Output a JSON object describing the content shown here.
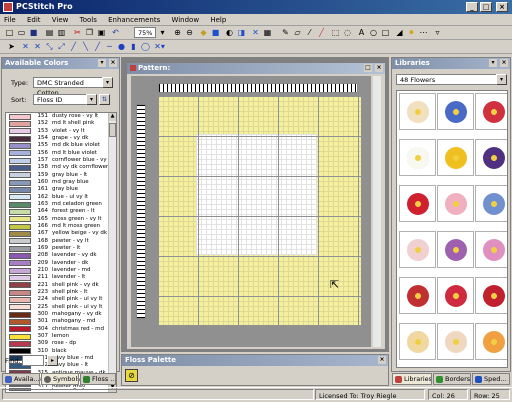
{
  "app": {
    "title": "PCStitch Pro"
  },
  "menu": [
    "File",
    "Edit",
    "View",
    "Tools",
    "Enhancements",
    "Window",
    "Help"
  ],
  "toolbar": {
    "zoom": "75%"
  },
  "available_colors": {
    "title": "Available Colors",
    "type_label": "Type:",
    "type_value": "DMC Stranded Cotton",
    "sort_label": "Sort:",
    "sort_value": "Floss ID",
    "find_label": "Find:",
    "colors": [
      {
        "id": "151",
        "name": "dusty rose - vy lt",
        "hex": "#f2c8cc"
      },
      {
        "id": "152",
        "name": "md lt shell pink",
        "hex": "#e0a4a0"
      },
      {
        "id": "153",
        "name": "violet - vy lt",
        "hex": "#e6cce2"
      },
      {
        "id": "154",
        "name": "grape - vy dk",
        "hex": "#4a2a3a"
      },
      {
        "id": "155",
        "name": "md dk blue violet",
        "hex": "#9890c8"
      },
      {
        "id": "156",
        "name": "md lt blue violet",
        "hex": "#a8b0dc"
      },
      {
        "id": "157",
        "name": "cornflower blue - vy lt",
        "hex": "#c0cce8"
      },
      {
        "id": "158",
        "name": "md vy dk cornflower bl",
        "hex": "#4a5a8a"
      },
      {
        "id": "159",
        "name": "gray blue - lt",
        "hex": "#c8d0e0"
      },
      {
        "id": "160",
        "name": "md gray blue",
        "hex": "#8898b8"
      },
      {
        "id": "161",
        "name": "gray blue",
        "hex": "#7888a8"
      },
      {
        "id": "162",
        "name": "blue - ul vy lt",
        "hex": "#d8e8f4"
      },
      {
        "id": "163",
        "name": "md celadon green",
        "hex": "#5a8a6a"
      },
      {
        "id": "164",
        "name": "forest green - lt",
        "hex": "#c8dca8"
      },
      {
        "id": "165",
        "name": "moss green - vy lt",
        "hex": "#e6e88a"
      },
      {
        "id": "166",
        "name": "md lt moss green",
        "hex": "#c0c846"
      },
      {
        "id": "167",
        "name": "yellow beige - vy dk",
        "hex": "#a08a4a"
      },
      {
        "id": "168",
        "name": "pewter - vy lt",
        "hex": "#c8ccce"
      },
      {
        "id": "169",
        "name": "pewter - lt",
        "hex": "#9a9ea0"
      },
      {
        "id": "208",
        "name": "lavender - vy dk",
        "hex": "#8a5ab0"
      },
      {
        "id": "209",
        "name": "lavender - dk",
        "hex": "#a87ec4"
      },
      {
        "id": "210",
        "name": "lavender - md",
        "hex": "#c8a6d8"
      },
      {
        "id": "211",
        "name": "lavender - lt",
        "hex": "#e0cce8"
      },
      {
        "id": "221",
        "name": "shell pink - vy dk",
        "hex": "#904048"
      },
      {
        "id": "223",
        "name": "shell pink - lt",
        "hex": "#c88888"
      },
      {
        "id": "224",
        "name": "shell pink - ul vy lt",
        "hex": "#e8b8b0"
      },
      {
        "id": "225",
        "name": "shell pink - ul vy lt",
        "hex": "#f8e0d8"
      },
      {
        "id": "300",
        "name": "mahogany - vy dk",
        "hex": "#6a2a14"
      },
      {
        "id": "301",
        "name": "mahogany - md",
        "hex": "#b0582c"
      },
      {
        "id": "304",
        "name": "christmas red - md",
        "hex": "#b8182a"
      },
      {
        "id": "307",
        "name": "lemon",
        "hex": "#fbe23a"
      },
      {
        "id": "309",
        "name": "rose - dp",
        "hex": "#b83a50"
      },
      {
        "id": "310",
        "name": "black",
        "hex": "#000000"
      },
      {
        "id": "311",
        "name": "navy blue - md",
        "hex": "#1e3a5a"
      },
      {
        "id": "312",
        "name": "navy blue - lt",
        "hex": "#355a80"
      },
      {
        "id": "315",
        "name": "antique mauve - dk",
        "hex": "#7a3a48"
      },
      {
        "id": "316",
        "name": "antique mauve - md",
        "hex": "#b87a88"
      },
      {
        "id": "317",
        "name": "pewter gray",
        "hex": "#6a6a6e"
      }
    ]
  },
  "pattern": {
    "title": "Pattern:"
  },
  "floss_palette": {
    "title": "Floss Palette"
  },
  "libraries": {
    "title": "Libraries",
    "selected": "48 Flowers"
  },
  "left_tabs": [
    "Availa...",
    "Symbols",
    "Floss ..."
  ],
  "right_tabs": [
    "Libraries",
    "Borders",
    "Sped..."
  ],
  "status": {
    "license": "Licensed To: Troy Riegle",
    "col_label": "Col:",
    "col": "26",
    "row_label": "Row:",
    "row": "25"
  },
  "flowers": [
    "#f0e0c0",
    "#4a6ac8",
    "#d03040",
    "#f8f8f0",
    "#f0c020",
    "#503080",
    "#d02030",
    "#f0b0c0",
    "#7090d0",
    "#f0d0d0",
    "#a060b0",
    "#e090c0",
    "#c03030",
    "#d02a40",
    "#c02030",
    "#f0d8a0",
    "#f0d8c0",
    "#f0a040"
  ]
}
